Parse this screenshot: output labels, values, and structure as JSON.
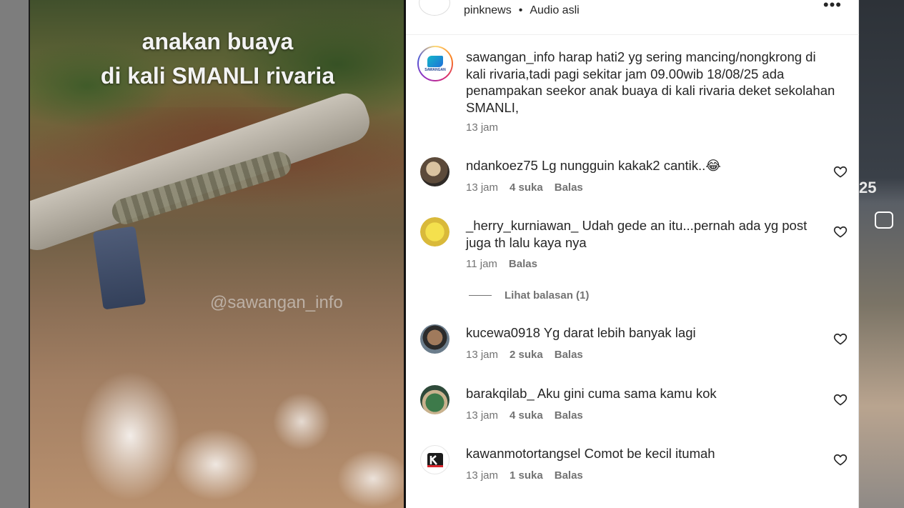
{
  "video": {
    "caption_line1": "anakan buaya",
    "caption_line2": "di kali SMANLI rivaria",
    "watermark": "@sawangan_info"
  },
  "header": {
    "credit": "pinknews",
    "separator": "•",
    "audio": "Audio asli",
    "more_icon": "more-icon"
  },
  "post": {
    "username": "sawangan_info",
    "text": "harap hati2 yg sering mancing/nongkrong di kali rivaria,tadi pagi sekitar jam 09.00wib 18/08/25 ada penampakan seekor anak buaya di kali rivaria deket sekolahan SMANLI,",
    "time": "13 jam"
  },
  "comments": [
    {
      "username": "ndankoez75",
      "text": "Lg nungguin kakak2 cantik..😂",
      "time": "13 jam",
      "likes": "4 suka",
      "reply": "Balas"
    },
    {
      "username": "_herry_kurniawan_",
      "text": "Udah gede an itu...pernah ada yg post juga th lalu kaya nya",
      "time": "11 jam",
      "likes": "",
      "reply": "Balas"
    },
    {
      "username": "kucewa0918",
      "text": "Yg darat lebih banyak lagi",
      "time": "13 jam",
      "likes": "2 suka",
      "reply": "Balas"
    },
    {
      "username": "barakqilab_",
      "text": "Aku gini cuma sama kamu kok",
      "time": "13 jam",
      "likes": "4 suka",
      "reply": "Balas"
    },
    {
      "username": "kawanmotortangsel",
      "text": "Comot be kecil itumah",
      "time": "13 jam",
      "likes": "1 suka",
      "reply": "Balas"
    }
  ],
  "view_replies": "Lihat balasan (1)",
  "right_strip": {
    "number": "25"
  },
  "colors": {
    "text": "#262626",
    "secondary": "#737373",
    "panel": "#ffffff"
  }
}
